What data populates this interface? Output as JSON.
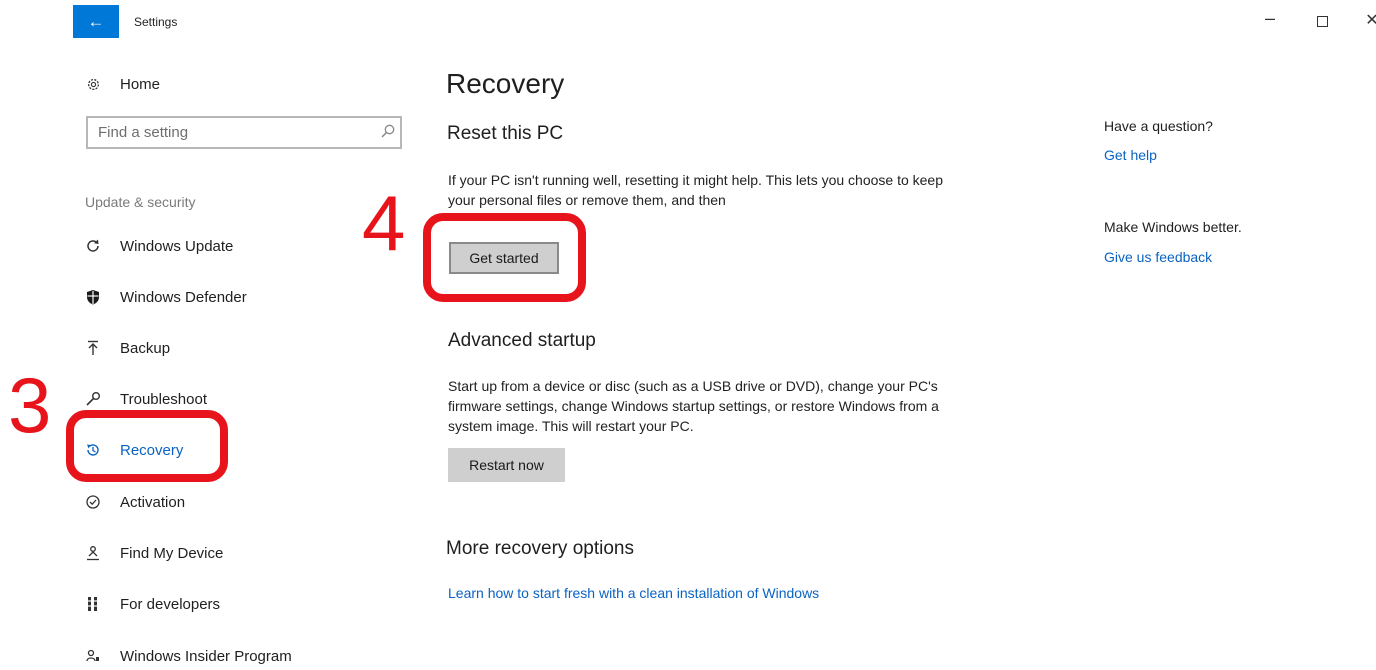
{
  "window": {
    "title": "Settings",
    "back_icon": "←",
    "minimize_icon": "–",
    "close_icon": "✕"
  },
  "sidebar": {
    "home_label": "Home",
    "search_placeholder": "Find a setting",
    "section_label": "Update & security",
    "selected": "Recovery",
    "items": [
      {
        "label": "Windows Update",
        "icon": "refresh-icon"
      },
      {
        "label": "Windows Defender",
        "icon": "shield-icon"
      },
      {
        "label": "Backup",
        "icon": "upload-icon"
      },
      {
        "label": "Troubleshoot",
        "icon": "wrench-icon"
      },
      {
        "label": "Recovery",
        "icon": "history-icon"
      },
      {
        "label": "Activation",
        "icon": "check-circle-icon"
      },
      {
        "label": "Find My Device",
        "icon": "person-pin-icon"
      },
      {
        "label": "For developers",
        "icon": "developer-tools-icon"
      },
      {
        "label": "Windows Insider Program",
        "icon": "insider-icon"
      }
    ]
  },
  "main": {
    "title": "Recovery",
    "reset": {
      "heading": "Reset this PC",
      "description": "If your PC isn't running well, resetting it might help. This lets you choose to keep your personal files or remove them, and then",
      "button": "Get started"
    },
    "advanced": {
      "heading": "Advanced startup",
      "description": "Start up from a device or disc (such as a USB drive or DVD), change your PC's firmware settings, change Windows startup settings, or restore Windows from a system image. This will restart your PC.",
      "button": "Restart now"
    },
    "more": {
      "heading": "More recovery options",
      "link": "Learn how to start fresh with a clean installation of Windows"
    }
  },
  "aside": {
    "question": "Have a question?",
    "get_help": "Get help",
    "better": "Make Windows better.",
    "feedback": "Give us feedback"
  },
  "annotations": {
    "step_3": "3",
    "step_4": "4",
    "color": "#e8141c"
  },
  "colors": {
    "accent": "#0078d7",
    "link": "#0a63c2"
  }
}
